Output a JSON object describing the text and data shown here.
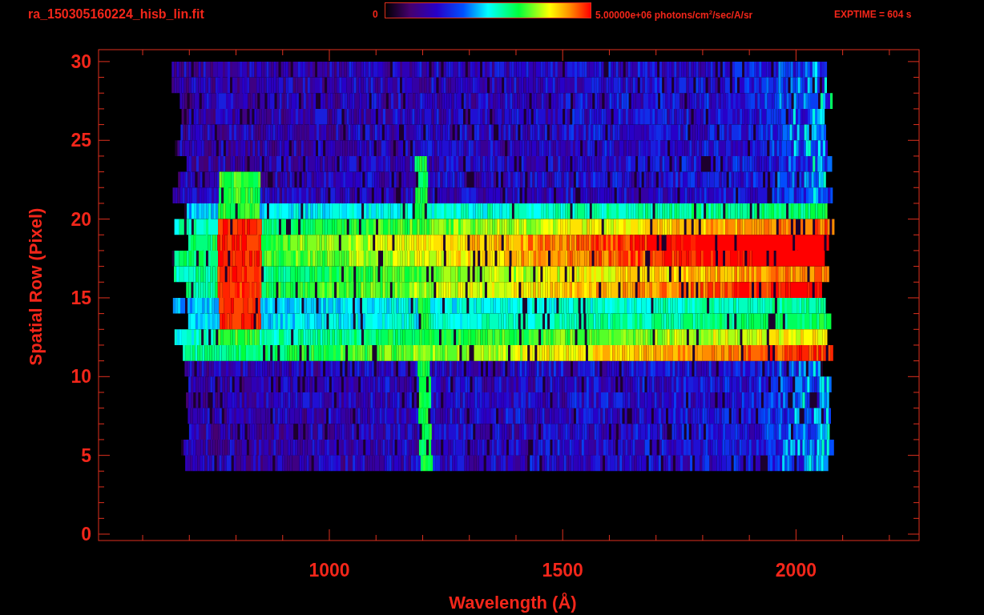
{
  "title": "ra_150305160224_hisb_lin.fit",
  "colorbar": {
    "min_label": "0",
    "max_label": "5.00000e+06 photons/cm$^{2}$/sec/A/sr"
  },
  "exposure": "EXPTIME = 604 s",
  "y_axis": {
    "label": "Spatial Row (Pixel)",
    "ticks": [
      "30",
      "25",
      "20",
      "15",
      "10",
      "5",
      "0"
    ]
  },
  "x_axis": {
    "label": "Wavelength (Å)",
    "ticks": [
      "1000",
      "1500",
      "2000"
    ]
  }
}
